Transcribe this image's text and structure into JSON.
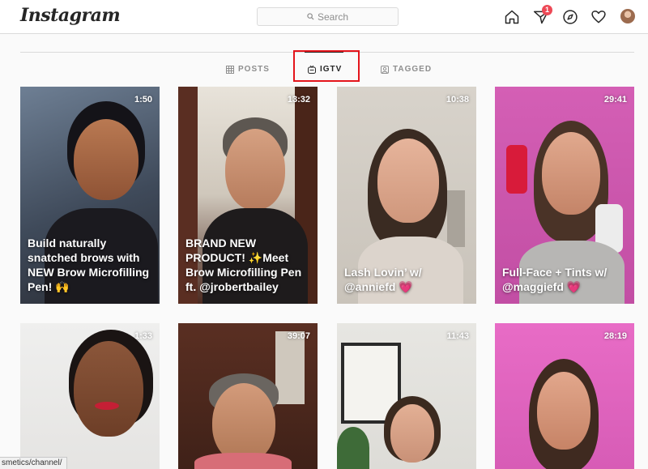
{
  "header": {
    "logo": "Instagram",
    "search_placeholder": "Search",
    "notification_count": "1"
  },
  "tabs": [
    {
      "label": "POSTS",
      "icon": "grid-icon",
      "active": false
    },
    {
      "label": "IGTV",
      "icon": "igtv-icon",
      "active": true
    },
    {
      "label": "TAGGED",
      "icon": "tagged-icon",
      "active": false
    }
  ],
  "videos": [
    {
      "duration": "1:50",
      "caption": "Build naturally snatched brows with NEW Brow Microfilling Pen! 🙌"
    },
    {
      "duration": "13:32",
      "caption": "BRAND NEW PRODUCT! ✨Meet Brow Microfilling Pen ft. @jrobertbailey"
    },
    {
      "duration": "10:38",
      "caption": "Lash Lovin’ w/ @anniefd 💗"
    },
    {
      "duration": "29:41",
      "caption": "Full-Face + Tints w/ @maggiefd 💗"
    },
    {
      "duration": "1:33",
      "caption": ""
    },
    {
      "duration": "39:07",
      "caption": ""
    },
    {
      "duration": "11:43",
      "caption": ""
    },
    {
      "duration": "28:19",
      "caption": ""
    }
  ],
  "status_bar": {
    "url": "smetics/channel/"
  },
  "colors": {
    "highlight": "#e4141b",
    "badge": "#ed4956"
  }
}
